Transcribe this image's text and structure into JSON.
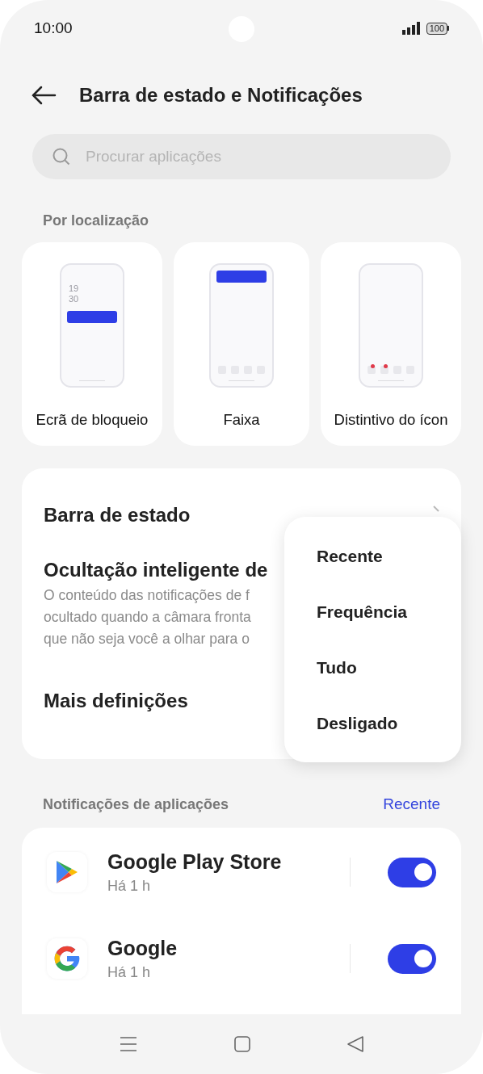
{
  "status_bar": {
    "time": "10:00",
    "battery": "100"
  },
  "header": {
    "title": "Barra de estado e Notificações"
  },
  "search": {
    "placeholder": "Procurar aplicações"
  },
  "location_section": {
    "title": "Por localização"
  },
  "location_cards": [
    {
      "kind": "lockscreen",
      "label": "Ecrã de bloqueio",
      "clock_lines": [
        "19",
        "30"
      ]
    },
    {
      "kind": "banner",
      "label": "Faixa"
    },
    {
      "kind": "badge",
      "label": "Distintivo do ícon"
    }
  ],
  "settings": [
    {
      "kind": "link",
      "title": "Barra de estado"
    },
    {
      "kind": "toggle",
      "title": "Ocultação inteligente de",
      "description_lines": [
        "O conteúdo das notificações de f",
        "ocultado quando a câmara fronta",
        "que não seja você a olhar para o"
      ]
    },
    {
      "kind": "link",
      "title": "Mais definições"
    }
  ],
  "sort_menu": [
    "Recente",
    "Frequência",
    "Tudo",
    "Desligado"
  ],
  "apps_section": {
    "title": "Notificações de aplicações",
    "sort": "Recente"
  },
  "apps": [
    {
      "kind": "play",
      "name": "Google Play Store",
      "time": "Há 1 h",
      "on": true
    },
    {
      "kind": "google",
      "name": "Google",
      "time": "Há 1 h",
      "on": true
    }
  ]
}
